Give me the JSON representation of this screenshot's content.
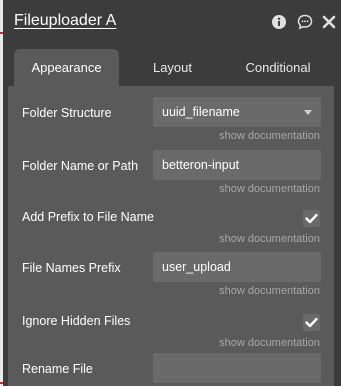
{
  "header": {
    "title": "Fileuploader A",
    "icons": [
      "info-icon",
      "chat-icon",
      "close-icon"
    ]
  },
  "tabs": [
    {
      "label": "Appearance",
      "active": true
    },
    {
      "label": "Layout",
      "active": false
    },
    {
      "label": "Conditional",
      "active": false
    }
  ],
  "properties": {
    "folder_structure": {
      "label": "Folder Structure",
      "value": "uuid_filename",
      "doc": "show documentation"
    },
    "folder_name": {
      "label": "Folder Name or Path",
      "value": "betteron-input",
      "doc": "show documentation"
    },
    "add_prefix": {
      "label": "Add Prefix to File Name",
      "checked": true,
      "doc": "show documentation"
    },
    "file_names_prefix": {
      "label": "File Names Prefix",
      "value": "user_upload",
      "doc": "show documentation"
    },
    "ignore_hidden": {
      "label": "Ignore Hidden Files",
      "checked": true,
      "doc": "show documentation"
    },
    "rename_file": {
      "label": "Rename File",
      "value": ""
    }
  },
  "colors": {
    "panel_bg": "#3c3c3c",
    "content_bg": "#5a5a5a",
    "field_bg": "#6a6a6a",
    "link_text": "#a8a8a8"
  }
}
